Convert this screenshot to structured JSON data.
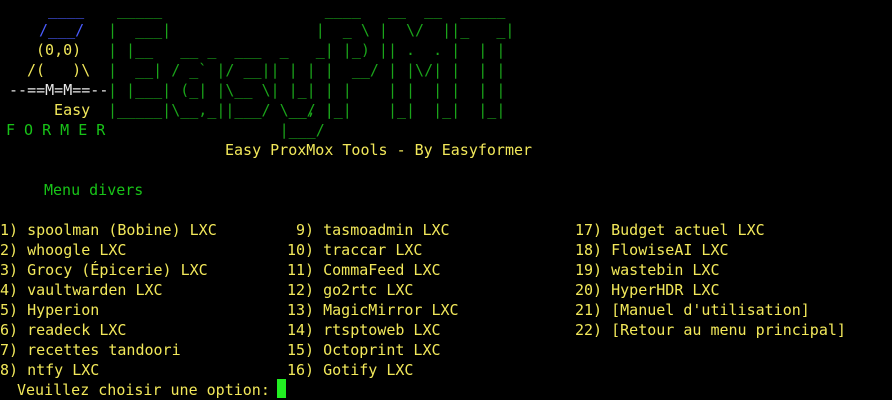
{
  "terminal": {
    "ascii_logo": {
      "owl": [
        "  ____",
        " /___/",
        " (0,0)",
        " /(   )\\",
        " --==M=M==--",
        "  Easy",
        "F O R M E R"
      ],
      "banner": [
        " _____                  ____   __  __  _____",
        "|  ___|                |  _ \\ |  \\/  ||_   _|",
        "| |__   __ _  ___  _   _| |_) || .  . |  | |",
        "|  __| / _` |/ __|| | | |  __/ | |\\/| |  | |",
        "| |___| (_| |\\__ \\| |_| | |    | |  | |  | |",
        "|_____|\\__,_||___/ \\__, |_|    |_|  |_|  |_|",
        "                    __/ |",
        "                   |___/"
      ]
    },
    "subtitle": "Easy ProxMox Tools - By Easyformer",
    "section_title": "Menu divers",
    "menu_columns": [
      [
        "1) spoolman (Bobine) LXC",
        "2) whoogle LXC",
        "3) Grocy (Épicerie) LXC",
        "4) vaultwarden LXC",
        "5) Hyperion",
        "6) readeck LXC",
        "7) recettes tandoori",
        "8) ntfy LXC"
      ],
      [
        " 9) tasmoadmin LXC",
        "10) traccar LXC",
        "11) CommaFeed LXC",
        "12) go2rtc LXC",
        "13) MagicMirror LXC",
        "14) rtsptoweb LXC",
        "15) Octoprint LXC",
        "16) Gotify LXC"
      ],
      [
        "17) Budget actuel LXC",
        "18) FlowiseAI LXC",
        "19) wastebin LXC",
        "20) HyperHDR LXC",
        "21) [Manuel d'utilisation]",
        "22) [Retour au menu principal]"
      ]
    ],
    "prompt": "Veuillez choisir une option: ",
    "colors": {
      "background": "#000000",
      "menu_text": "#f2e85a",
      "accent_green": "#18c418",
      "cursor": "#22ee22",
      "owl_blue": "#4a5cff"
    }
  }
}
